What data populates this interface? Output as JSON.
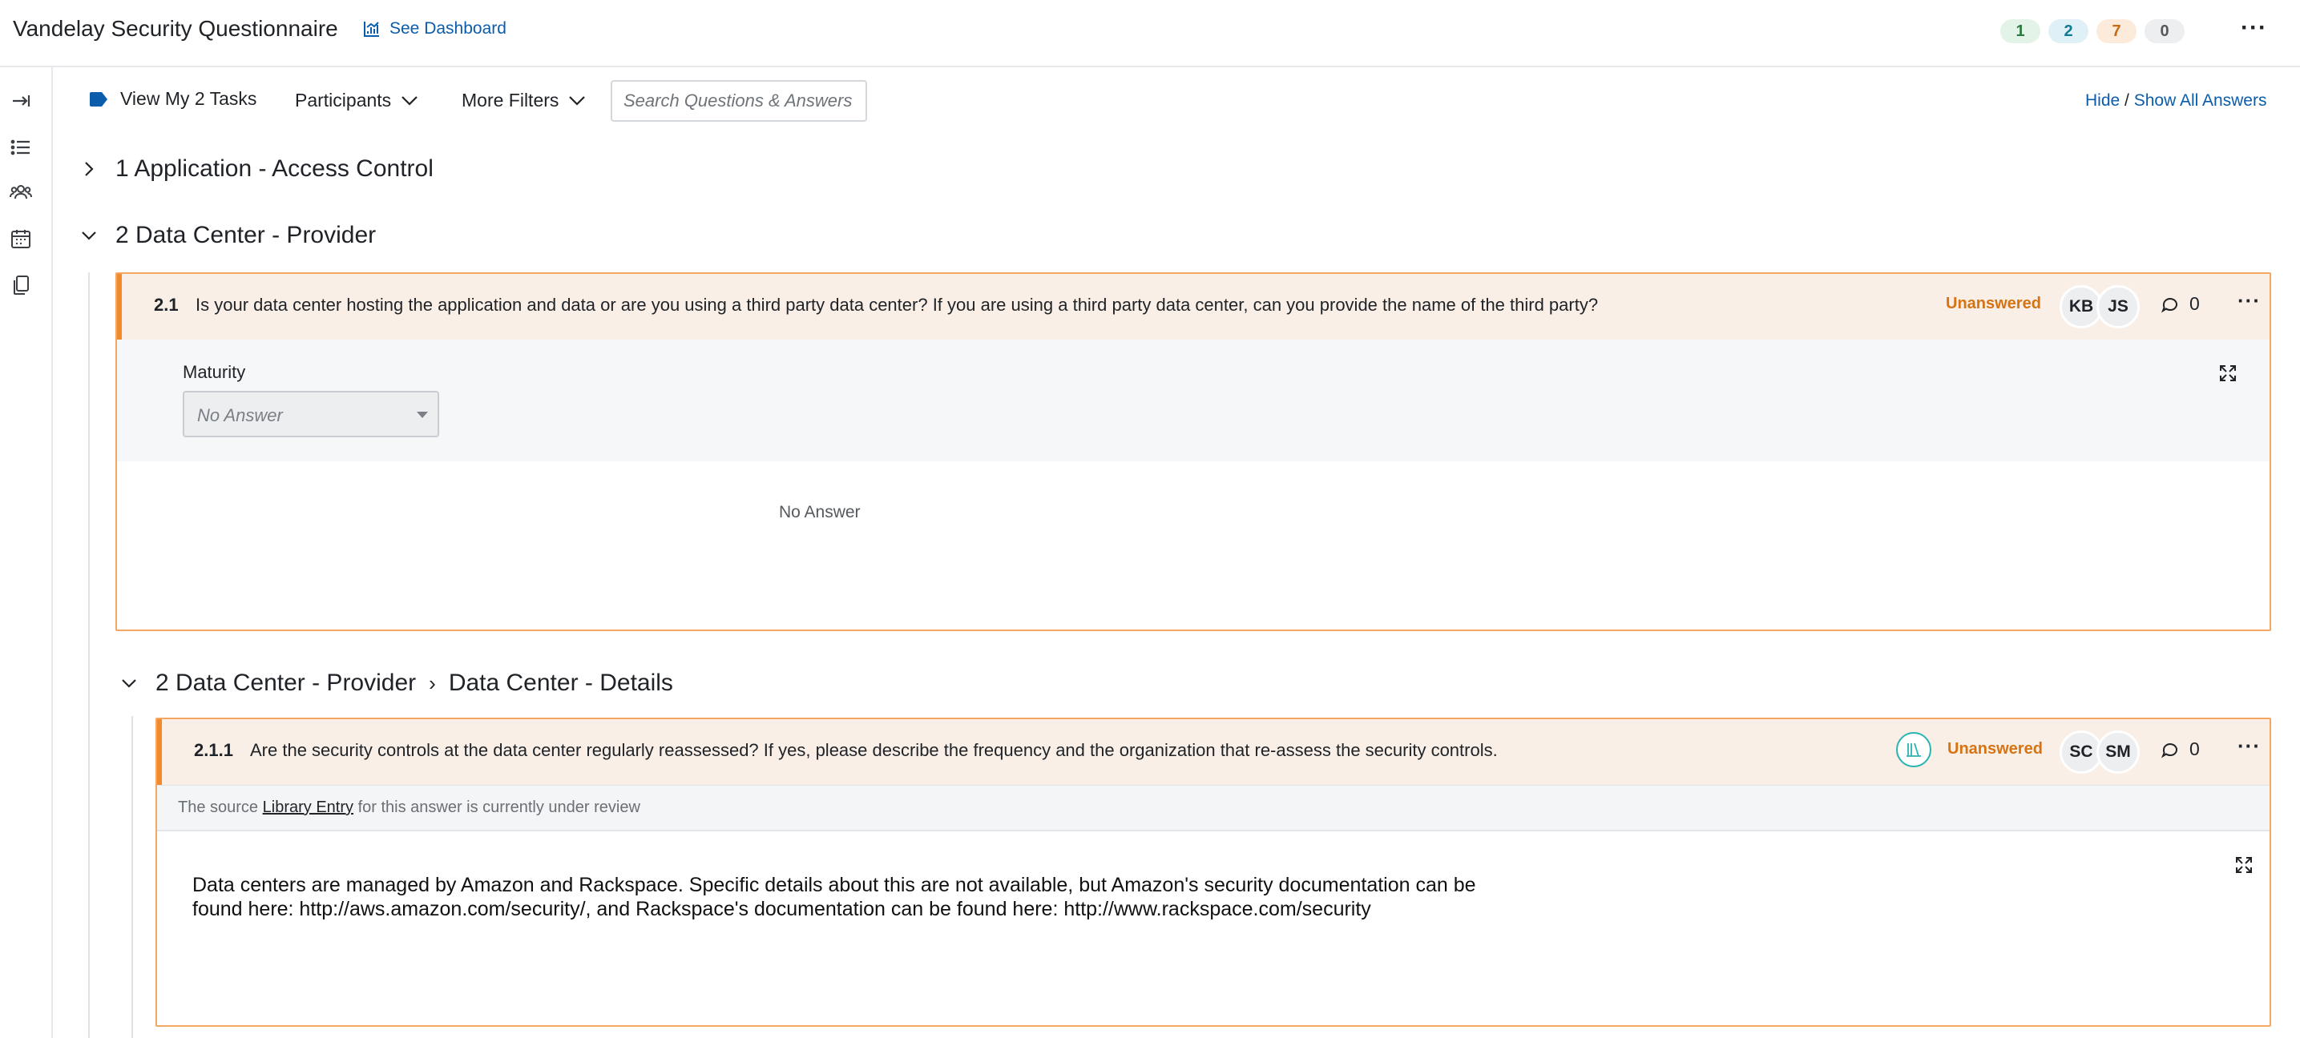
{
  "header": {
    "title": "Vandelay Security Questionnaire",
    "dashboard_link": "See Dashboard",
    "counters": [
      {
        "value": "1",
        "color": "#2c7a3f"
      },
      {
        "value": "2",
        "color": "#117a95"
      },
      {
        "value": "7",
        "color": "#c86a14"
      },
      {
        "value": "0",
        "color": "#55595e"
      }
    ],
    "more_icon": "ellipsis-icon"
  },
  "sidebar": {
    "icons": [
      "collapse-arrow-icon",
      "list-icon",
      "participants-icon",
      "calendar-icon",
      "copy-icon"
    ]
  },
  "toolbar": {
    "tasks_label": "View My 2 Tasks",
    "participants_label": "Participants",
    "filters_label": "More Filters",
    "search_placeholder": "Search Questions & Answers",
    "hide_label": "Hide",
    "separator": "/",
    "show_all_label": "Show All Answers"
  },
  "sections": [
    {
      "title": "1 Application - Access Control",
      "expanded": false
    },
    {
      "title": "2 Data Center - Provider",
      "expanded": true
    }
  ],
  "subsection": {
    "parent": "2 Data Center - Provider",
    "separator": "›",
    "title": "Data Center - Details"
  },
  "questions": [
    {
      "number": "2.1",
      "text": "Is your data center hosting the application and data or are you using a third party data center? If you are using a third party data center, can you provide the name of the third party?",
      "status": "Unanswered",
      "assignees": [
        "KB",
        "JS"
      ],
      "comments": "0",
      "maturity_label": "Maturity",
      "maturity_value": "No Answer",
      "answer": "No Answer"
    },
    {
      "number": "2.1.1",
      "text": "Are the security controls at the data center regularly reassessed? If yes, please describe the frequency and the organization that re-assess the security controls.",
      "status": "Unanswered",
      "assignees": [
        "SC",
        "SM"
      ],
      "comments": "0",
      "review_prefix": "The source",
      "review_link": "Library Entry",
      "review_suffix": "for this answer is currently under review",
      "answer_line1": "Data centers are managed by Amazon and Rackspace. Specific details about this are not available, but Amazon's security documentation can be",
      "answer_line2": "found here: http://aws.amazon.com/security/, and Rackspace's documentation can be found here: http://www.rackspace.com/security"
    }
  ]
}
